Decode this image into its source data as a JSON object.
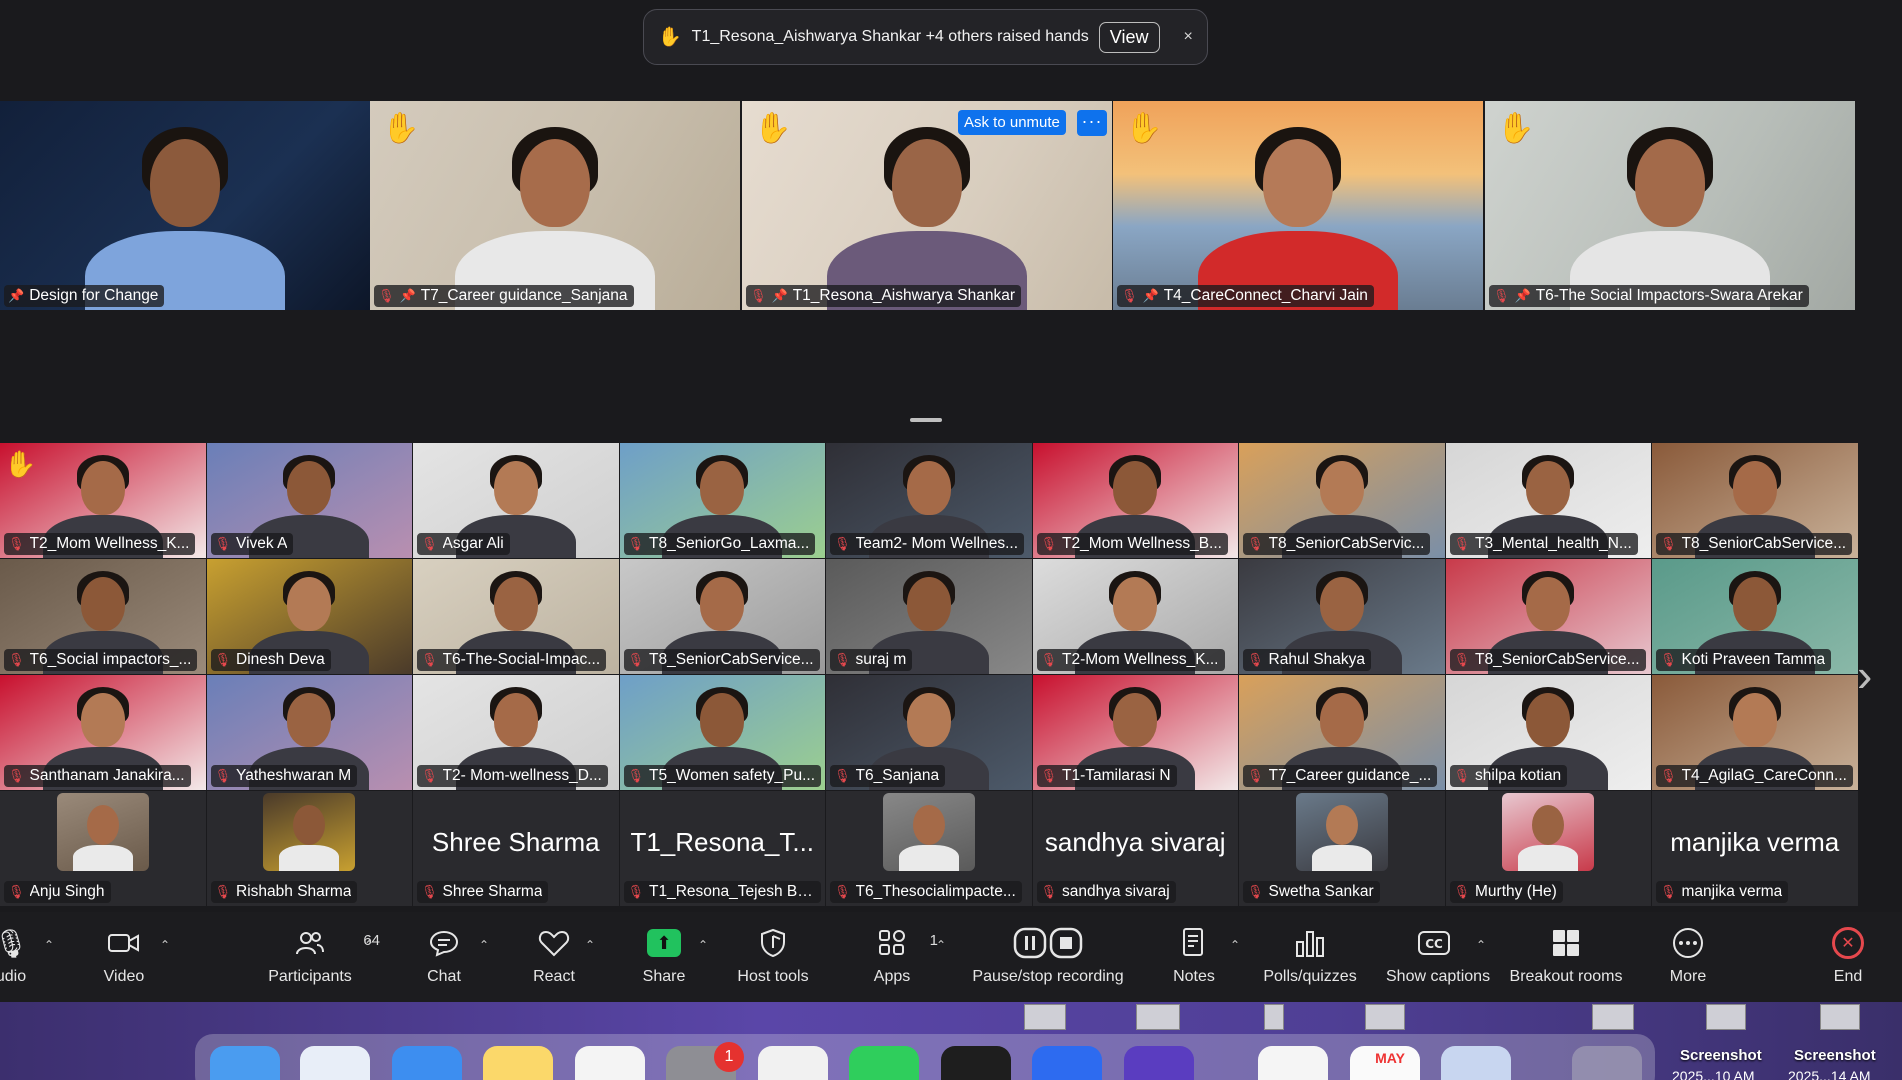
{
  "notification": {
    "icon": "raised-hand-icon",
    "text": "T1_Resona_Aishwarya Shankar +4 others raised hands",
    "view_label": "View",
    "close_label": "×"
  },
  "spotlight": {
    "ask_unmute_label": "Ask to unmute",
    "more_label": "···",
    "tiles": [
      {
        "name": "Design for Change",
        "raised_hand": false,
        "muted": false,
        "active_speaker": true
      },
      {
        "name": "T7_Career guidance_Sanjana",
        "raised_hand": true,
        "muted": true
      },
      {
        "name": "T1_Resona_Aishwarya Shankar",
        "raised_hand": true,
        "muted": true
      },
      {
        "name": "T4_CareConnect_Charvi Jain",
        "raised_hand": true,
        "muted": true
      },
      {
        "name": "T6-The Social Impactors-Swara Arekar",
        "raised_hand": true,
        "muted": true
      }
    ]
  },
  "gallery": {
    "rows": [
      [
        "T2_Mom Wellness_K...",
        "Vivek A",
        "Asgar Ali",
        "T8_SeniorGo_Laxma...",
        "Team2- Mom Wellnes...",
        "T2_Mom Wellness_B...",
        "T8_SeniorCabServic...",
        "T3_Mental_health_N...",
        "T8_SeniorCabService..."
      ],
      [
        "T6_Social impactors_...",
        "Dinesh Deva",
        "T6-The-Social-Impac...",
        "T8_SeniorCabService...",
        "suraj m",
        "T2-Mom Wellness_K...",
        "Rahul Shakya",
        "T8_SeniorCabService...",
        "Koti Praveen Tamma"
      ],
      [
        "Santhanam Janakira...",
        "Yatheshwaran M",
        "T2- Mom-wellness_D...",
        "T5_Women safety_Pu...",
        "T6_Sanjana",
        "T1-Tamilarasi N",
        "T7_Career guidance_...",
        "shilpa kotian",
        "T4_AgilaG_CareConn..."
      ],
      [
        "Anju Singh",
        "Rishabh Sharma",
        "Shree Sharma",
        "T1_Resona_Tejesh Ba...",
        "T6_Thesocialimpacte...",
        "sandhya sivaraj",
        "Swetha Sankar",
        "Murthy (He)",
        "manjika verma"
      ]
    ],
    "display_names_no_video": {
      "Shree Sharma": "Shree Sharma",
      "T1_Resona_Tejesh Ba...": "T1_Resona_T...",
      "sandhya sivaraj": "sandhya sivaraj",
      "manjika verma": "manjika verma"
    },
    "raised_hand_first_tile": true,
    "next_page_icon": "chevron-right-icon"
  },
  "toolbar": {
    "audio": {
      "label": "udio",
      "icon": "microphone-icon"
    },
    "video": {
      "label": "Video",
      "icon": "video-camera-icon"
    },
    "participants": {
      "label": "Participants",
      "count": "64",
      "icon": "participants-icon"
    },
    "chat": {
      "label": "Chat",
      "icon": "chat-icon"
    },
    "react": {
      "label": "React",
      "icon": "heart-icon"
    },
    "share": {
      "label": "Share",
      "icon": "share-screen-icon",
      "color": "#21c25e"
    },
    "host_tools": {
      "label": "Host tools",
      "icon": "shield-icon"
    },
    "apps": {
      "label": "Apps",
      "count": "1",
      "icon": "apps-icon"
    },
    "recording": {
      "label": "Pause/stop recording",
      "icon": "pause-stop-icon"
    },
    "notes": {
      "label": "Notes",
      "icon": "notes-icon"
    },
    "polls": {
      "label": "Polls/quizzes",
      "icon": "bar-chart-icon"
    },
    "captions": {
      "label": "Show captions",
      "icon": "cc-icon"
    },
    "breakout": {
      "label": "Breakout rooms",
      "icon": "grid-icon"
    },
    "more": {
      "label": "More",
      "icon": "ellipsis-icon"
    },
    "end": {
      "label": "End",
      "icon": "end-icon",
      "color": "#e5484d"
    }
  },
  "dock": {
    "chrome_badge": "1",
    "calendar_month": "MAY",
    "desktop_items": [
      {
        "title": "Screenshot",
        "subtitle": "2025...10 AM"
      },
      {
        "title": "Screenshot",
        "subtitle": "2025...14 AM"
      }
    ]
  },
  "colors": {
    "active_speaker_border": "#36d43b",
    "accent_blue": "#0e72ed",
    "muted_red": "#e5484d"
  }
}
